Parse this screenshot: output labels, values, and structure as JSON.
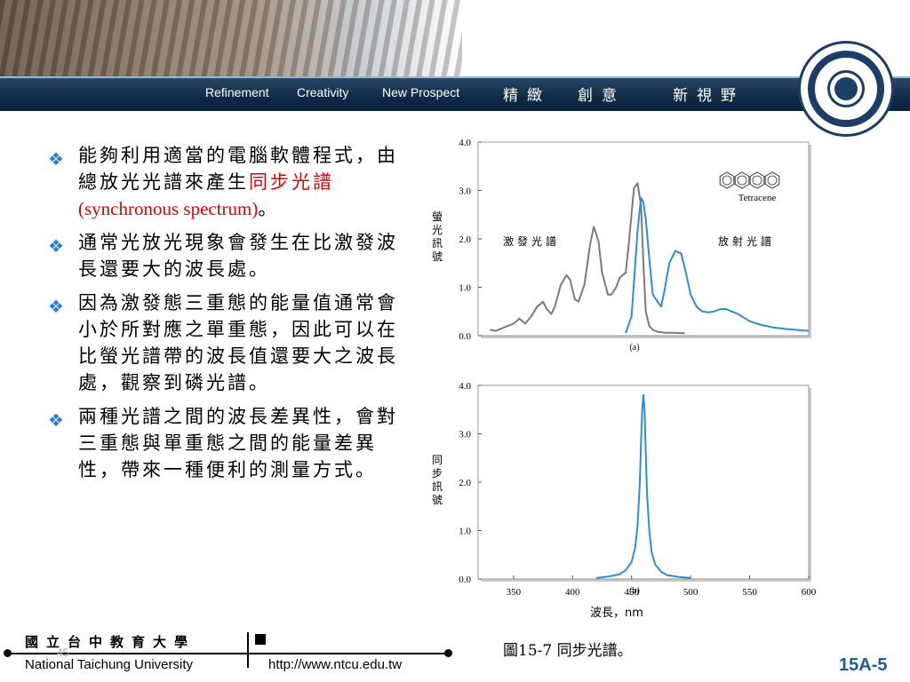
{
  "header": {
    "slogans": [
      "Refinement",
      "Creativity",
      "New Prospect"
    ],
    "slogans_cn": [
      "精緻",
      "創意",
      "新視野"
    ]
  },
  "bullets": [
    {
      "pre": "能夠利用適當的電腦軟體程式，由總放光光譜來產生",
      "highlight": "同步光譜",
      "latin": "(synchronous spectrum)",
      "post": "。"
    },
    {
      "text": "通常光放光現象會發生在比激發波長還要大的波長處。"
    },
    {
      "text": "因為激發態三重態的能量值通常會小於所對應之單重態，因此可以在比螢光譜帶的波長值還要大之波長處，觀察到磷光譜。"
    },
    {
      "text": "兩種光譜之間的波長差異性，會對三重態與單重態之間的能量差異性，帶來一種便利的測量方式。"
    }
  ],
  "caption": "圖15-7 同步光譜。",
  "footer": {
    "school_cn": "國立台中教育大學",
    "school_en": "National Taichung University",
    "url": "http://www.ntcu.edu.tw",
    "page_number": "45",
    "slide_id": "15A-5"
  },
  "colors": {
    "accent_blue": "#2b8fd8",
    "gray_curve": "#7a7a7a",
    "highlight_red": "#e00000"
  },
  "chart_data": [
    {
      "type": "line",
      "panel_label": "(a)",
      "ylabel": "螢光訊號",
      "ylim": [
        0,
        4.0
      ],
      "yticks": [
        "0.0",
        "1.0",
        "2.0",
        "3.0",
        "4.0"
      ],
      "xlim": [
        320,
        600
      ],
      "molecule_label": "Tetracene",
      "annotations": [
        "激發光譜",
        "放射光譜"
      ],
      "series": [
        {
          "name": "激發光譜",
          "color": "#7a7a7a",
          "x": [
            330,
            335,
            340,
            345,
            350,
            355,
            360,
            365,
            370,
            375,
            378,
            382,
            385,
            390,
            395,
            398,
            402,
            405,
            410,
            415,
            418,
            422,
            425,
            430,
            433,
            437,
            440,
            445,
            448,
            452,
            455,
            458,
            460,
            462,
            465,
            468,
            472,
            478,
            485,
            495
          ],
          "y": [
            0.12,
            0.1,
            0.15,
            0.2,
            0.25,
            0.35,
            0.25,
            0.4,
            0.6,
            0.7,
            0.55,
            0.45,
            0.6,
            1.05,
            1.25,
            1.15,
            0.75,
            0.7,
            1.05,
            1.9,
            2.25,
            1.95,
            1.3,
            0.85,
            0.85,
            1.0,
            1.2,
            1.3,
            2.0,
            3.05,
            3.15,
            2.7,
            1.5,
            0.5,
            0.2,
            0.12,
            0.08,
            0.06,
            0.06,
            0.05
          ]
        },
        {
          "name": "放射光譜",
          "color": "#2b8fd8",
          "x": [
            445,
            450,
            452,
            455,
            458,
            460,
            462,
            465,
            468,
            472,
            475,
            478,
            482,
            487,
            492,
            496,
            500,
            505,
            510,
            515,
            520,
            525,
            530,
            535,
            540,
            550,
            560,
            570,
            580,
            590,
            600
          ],
          "y": [
            0.05,
            0.4,
            1.1,
            2.15,
            2.85,
            2.75,
            2.4,
            1.6,
            0.85,
            0.7,
            0.6,
            0.95,
            1.5,
            1.75,
            1.7,
            1.3,
            0.85,
            0.6,
            0.5,
            0.48,
            0.5,
            0.55,
            0.55,
            0.5,
            0.45,
            0.3,
            0.22,
            0.17,
            0.14,
            0.12,
            0.1
          ]
        }
      ]
    },
    {
      "type": "line",
      "panel_label": "(b)",
      "ylabel": "同步訊號",
      "xlabel": "波長，nm",
      "ylim": [
        0,
        4.0
      ],
      "yticks": [
        "0.0",
        "1.0",
        "2.0",
        "3.0",
        "4.0"
      ],
      "xlim": [
        320,
        600
      ],
      "xticks": [
        "350",
        "400",
        "450",
        "500",
        "550",
        "600"
      ],
      "series": [
        {
          "color": "#2b8fd8",
          "x": [
            420,
            430,
            440,
            445,
            450,
            453,
            455,
            457,
            458,
            459,
            460,
            461,
            462,
            463,
            465,
            467,
            470,
            475,
            480,
            490,
            500
          ],
          "y": [
            0.02,
            0.05,
            0.1,
            0.18,
            0.35,
            0.65,
            1.1,
            2.0,
            2.8,
            3.5,
            3.8,
            3.5,
            2.6,
            1.8,
            1.0,
            0.55,
            0.3,
            0.15,
            0.08,
            0.04,
            0.02
          ]
        }
      ]
    }
  ]
}
